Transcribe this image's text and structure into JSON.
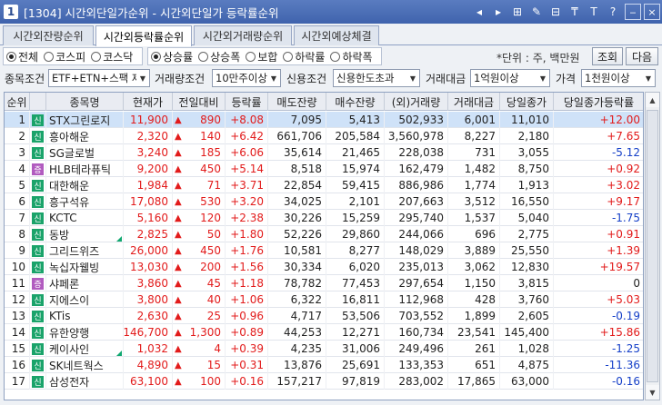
{
  "window": {
    "icon": "1",
    "title": "[1304] 시간외단일가순위 - 시간외단일가 등락률순위",
    "tools": [
      "◂",
      "▸",
      "⊞",
      "✎",
      "⊟",
      "₸",
      "T",
      "?",
      "‒",
      "×"
    ]
  },
  "tabs": [
    {
      "label": "시간외잔량순위",
      "active": false
    },
    {
      "label": "시간외등락률순위",
      "active": true
    },
    {
      "label": "시간외거래량순위",
      "active": false
    },
    {
      "label": "시간외예상체결",
      "active": false
    }
  ],
  "market_radios": [
    {
      "label": "전체",
      "checked": true
    },
    {
      "label": "코스피",
      "checked": false
    },
    {
      "label": "코스닥",
      "checked": false
    }
  ],
  "sort_radios": [
    {
      "label": "상승률",
      "checked": true
    },
    {
      "label": "상승폭",
      "checked": false
    },
    {
      "label": "보합",
      "checked": false
    },
    {
      "label": "하락률",
      "checked": false
    },
    {
      "label": "하락폭",
      "checked": false
    }
  ],
  "unit_text": "*단위 : 주, 백만원",
  "buttons": {
    "query": "조회",
    "next": "다음"
  },
  "filters": {
    "stock_cond_label": "종목조건",
    "stock_cond_value": "ETF+ETN+스팩 제",
    "volume_cond_label": "거래량조건",
    "volume_cond_value": "10만주이상",
    "credit_cond_label": "신용조건",
    "credit_cond_value": "신용한도초과",
    "amount_label": "거래대금",
    "amount_value": "1억원이상",
    "price_label": "가격",
    "price_value": "1천원이상"
  },
  "table": {
    "headers": [
      "순위",
      "",
      "종목명",
      "현재가",
      "전일대비",
      "등락률",
      "매도잔량",
      "매수잔량",
      "(외)거래량",
      "거래대금",
      "당일종가",
      "당일종가등락률"
    ],
    "rows": [
      {
        "rank": "1",
        "badge": "신",
        "name": "STX그린로지",
        "price": "11,900",
        "change": "890",
        "rate": "+8.08",
        "ask": "7,095",
        "bid": "5,413",
        "vol": "502,933",
        "amt": "6,001",
        "close": "11,010",
        "close_rate": "+12.00",
        "flag": false,
        "badge_type": "sin",
        "rate_color": "red",
        "close_color": "red"
      },
      {
        "rank": "2",
        "badge": "신",
        "name": "흥아해운",
        "price": "2,320",
        "change": "140",
        "rate": "+6.42",
        "ask": "661,706",
        "bid": "205,584",
        "vol": "3,560,978",
        "amt": "8,227",
        "close": "2,180",
        "close_rate": "+7.65",
        "flag": false,
        "badge_type": "sin",
        "rate_color": "red",
        "close_color": "red"
      },
      {
        "rank": "3",
        "badge": "신",
        "name": "SG글로벌",
        "price": "3,240",
        "change": "185",
        "rate": "+6.06",
        "ask": "35,614",
        "bid": "21,465",
        "vol": "228,038",
        "amt": "731",
        "close": "3,055",
        "close_rate": "-5.12",
        "flag": false,
        "badge_type": "sin",
        "rate_color": "red",
        "close_color": "blue"
      },
      {
        "rank": "4",
        "badge": "증",
        "name": "HLB테라퓨틱",
        "price": "9,200",
        "change": "450",
        "rate": "+5.14",
        "ask": "8,518",
        "bid": "15,974",
        "vol": "162,479",
        "amt": "1,482",
        "close": "8,750",
        "close_rate": "+0.92",
        "flag": false,
        "badge_type": "jeung",
        "rate_color": "red",
        "close_color": "red"
      },
      {
        "rank": "5",
        "badge": "신",
        "name": "대한해운",
        "price": "1,984",
        "change": "71",
        "rate": "+3.71",
        "ask": "22,854",
        "bid": "59,415",
        "vol": "886,986",
        "amt": "1,774",
        "close": "1,913",
        "close_rate": "+3.02",
        "flag": false,
        "badge_type": "sin",
        "rate_color": "red",
        "close_color": "red"
      },
      {
        "rank": "6",
        "badge": "신",
        "name": "흥구석유",
        "price": "17,080",
        "change": "530",
        "rate": "+3.20",
        "ask": "34,025",
        "bid": "2,101",
        "vol": "207,663",
        "amt": "3,512",
        "close": "16,550",
        "close_rate": "+9.17",
        "flag": false,
        "badge_type": "sin",
        "rate_color": "red",
        "close_color": "red"
      },
      {
        "rank": "7",
        "badge": "신",
        "name": "KCTC",
        "price": "5,160",
        "change": "120",
        "rate": "+2.38",
        "ask": "30,226",
        "bid": "15,259",
        "vol": "295,740",
        "amt": "1,537",
        "close": "5,040",
        "close_rate": "-1.75",
        "flag": false,
        "badge_type": "sin",
        "rate_color": "red",
        "close_color": "blue"
      },
      {
        "rank": "8",
        "badge": "신",
        "name": "동방",
        "price": "2,825",
        "change": "50",
        "rate": "+1.80",
        "ask": "52,226",
        "bid": "29,860",
        "vol": "244,066",
        "amt": "696",
        "close": "2,775",
        "close_rate": "+0.91",
        "flag": true,
        "badge_type": "sin",
        "rate_color": "red",
        "close_color": "red"
      },
      {
        "rank": "9",
        "badge": "신",
        "name": "그리드위즈",
        "price": "26,000",
        "change": "450",
        "rate": "+1.76",
        "ask": "10,581",
        "bid": "8,277",
        "vol": "148,029",
        "amt": "3,889",
        "close": "25,550",
        "close_rate": "+1.39",
        "flag": false,
        "badge_type": "sin",
        "rate_color": "red",
        "close_color": "red"
      },
      {
        "rank": "10",
        "badge": "신",
        "name": "녹십자웰빙",
        "price": "13,030",
        "change": "200",
        "rate": "+1.56",
        "ask": "30,334",
        "bid": "6,020",
        "vol": "235,013",
        "amt": "3,062",
        "close": "12,830",
        "close_rate": "+19.57",
        "flag": false,
        "badge_type": "sin",
        "rate_color": "red",
        "close_color": "red"
      },
      {
        "rank": "11",
        "badge": "증",
        "name": "샤페론",
        "price": "3,860",
        "change": "45",
        "rate": "+1.18",
        "ask": "78,782",
        "bid": "77,453",
        "vol": "297,654",
        "amt": "1,150",
        "close": "3,815",
        "close_rate": "0",
        "flag": false,
        "badge_type": "jeung",
        "rate_color": "red",
        "close_color": "plain"
      },
      {
        "rank": "12",
        "badge": "신",
        "name": "지에스이",
        "price": "3,800",
        "change": "40",
        "rate": "+1.06",
        "ask": "6,322",
        "bid": "16,811",
        "vol": "112,968",
        "amt": "428",
        "close": "3,760",
        "close_rate": "+5.03",
        "flag": false,
        "badge_type": "sin",
        "rate_color": "red",
        "close_color": "red"
      },
      {
        "rank": "13",
        "badge": "신",
        "name": "KTis",
        "price": "2,630",
        "change": "25",
        "rate": "+0.96",
        "ask": "4,717",
        "bid": "53,506",
        "vol": "703,552",
        "amt": "1,899",
        "close": "2,605",
        "close_rate": "-0.19",
        "flag": false,
        "badge_type": "sin",
        "rate_color": "red",
        "close_color": "blue"
      },
      {
        "rank": "14",
        "badge": "신",
        "name": "유한양행",
        "price": "146,700",
        "change": "1,300",
        "rate": "+0.89",
        "ask": "44,253",
        "bid": "12,271",
        "vol": "160,734",
        "amt": "23,541",
        "close": "145,400",
        "close_rate": "+15.86",
        "flag": false,
        "badge_type": "sin",
        "rate_color": "red",
        "close_color": "red"
      },
      {
        "rank": "15",
        "badge": "신",
        "name": "케이사인",
        "price": "1,032",
        "change": "4",
        "rate": "+0.39",
        "ask": "4,235",
        "bid": "31,006",
        "vol": "249,496",
        "amt": "261",
        "close": "1,028",
        "close_rate": "-1.25",
        "flag": true,
        "badge_type": "sin",
        "rate_color": "red",
        "close_color": "blue"
      },
      {
        "rank": "16",
        "badge": "신",
        "name": "SK네트웍스",
        "price": "4,890",
        "change": "15",
        "rate": "+0.31",
        "ask": "13,876",
        "bid": "25,691",
        "vol": "133,353",
        "amt": "651",
        "close": "4,875",
        "close_rate": "-11.36",
        "flag": false,
        "badge_type": "sin",
        "rate_color": "red",
        "close_color": "blue"
      },
      {
        "rank": "17",
        "badge": "신",
        "name": "삼성전자",
        "price": "63,100",
        "change": "100",
        "rate": "+0.16",
        "ask": "157,217",
        "bid": "97,819",
        "vol": "283,002",
        "amt": "17,865",
        "close": "63,000",
        "close_rate": "-0.16",
        "flag": false,
        "badge_type": "sin",
        "rate_color": "red",
        "close_color": "blue"
      }
    ]
  },
  "colors": {
    "up": "#e21b1b",
    "down": "#1640c8",
    "selected_row": "#cfe2f8",
    "title_bar": "#3f63ad"
  }
}
